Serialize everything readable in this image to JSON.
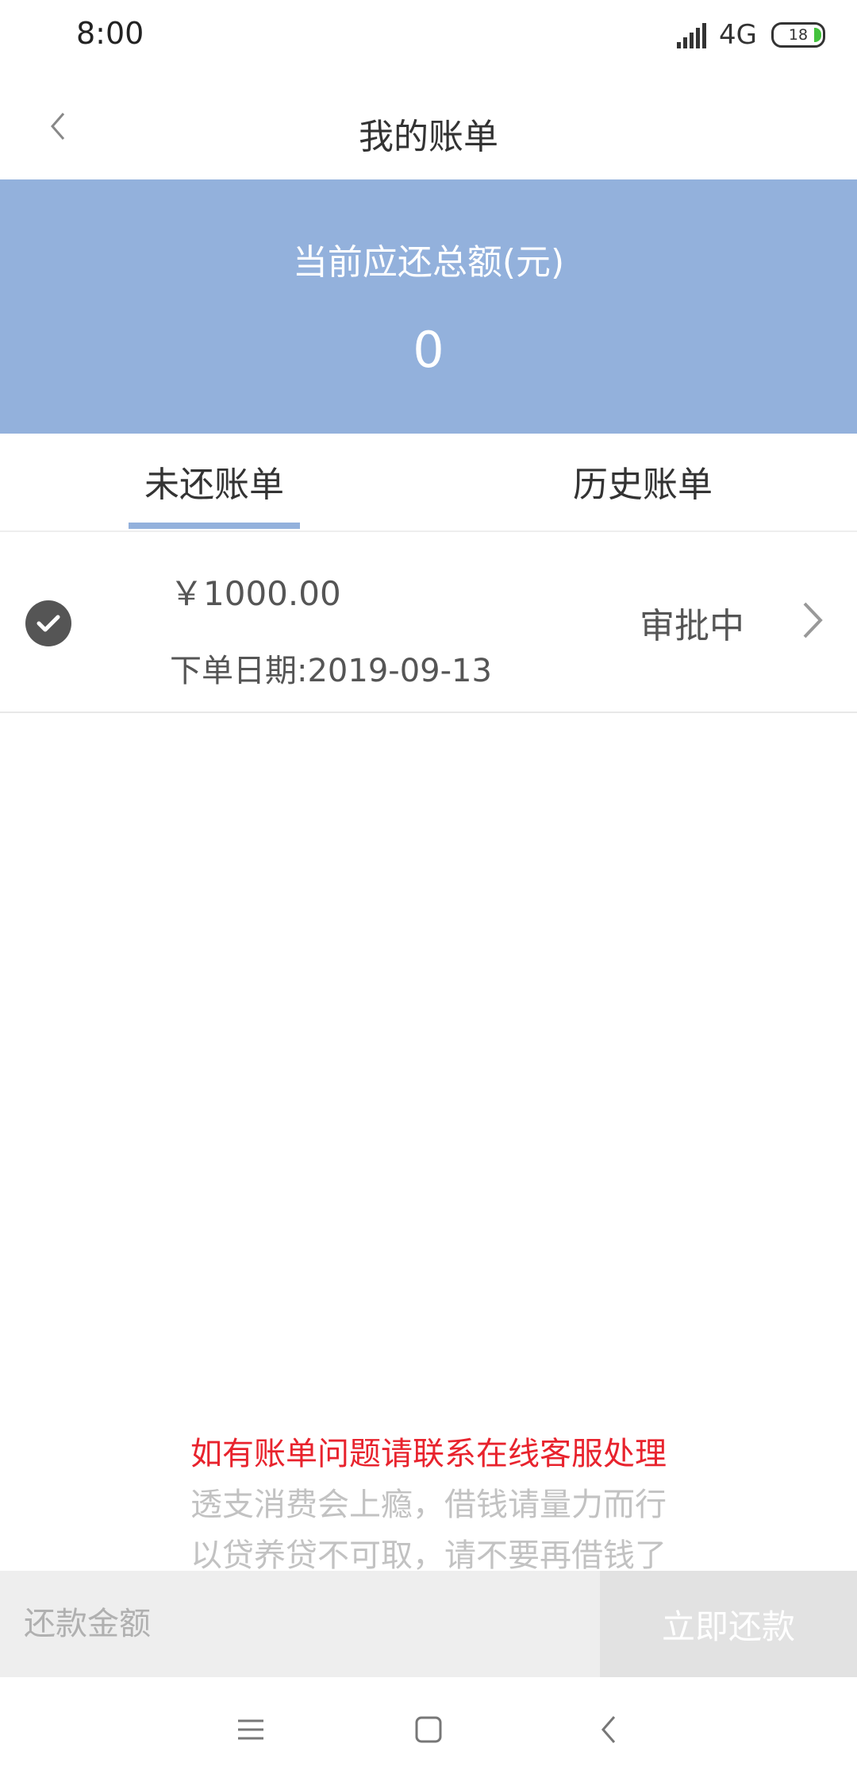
{
  "status_bar": {
    "time": "8:00",
    "network": "4G",
    "battery": "18"
  },
  "header": {
    "title": "我的账单",
    "back_icon": "chevron-left-icon"
  },
  "summary": {
    "label": "当前应还总额(元)",
    "amount": "0",
    "background_color": "#93b1dc"
  },
  "tabs": [
    {
      "label": "未还账单",
      "active": true
    },
    {
      "label": "历史账单",
      "active": false
    }
  ],
  "bills": [
    {
      "amount": "￥1000.00",
      "date": "下单日期:2019-09-13",
      "status": "审批中",
      "icon": "check-circle-icon"
    }
  ],
  "notices": {
    "contact": "如有账单问题请联系在线客服处理",
    "line1": "透支消费会上瘾，借钱请量力而行",
    "line2": "以贷养贷不可取，请不要再借钱了",
    "contact_color": "#e8232d"
  },
  "payment": {
    "placeholder": "还款金额",
    "button_label": "立即还款"
  },
  "system_nav": [
    "menu-icon",
    "home-icon",
    "back-icon"
  ]
}
